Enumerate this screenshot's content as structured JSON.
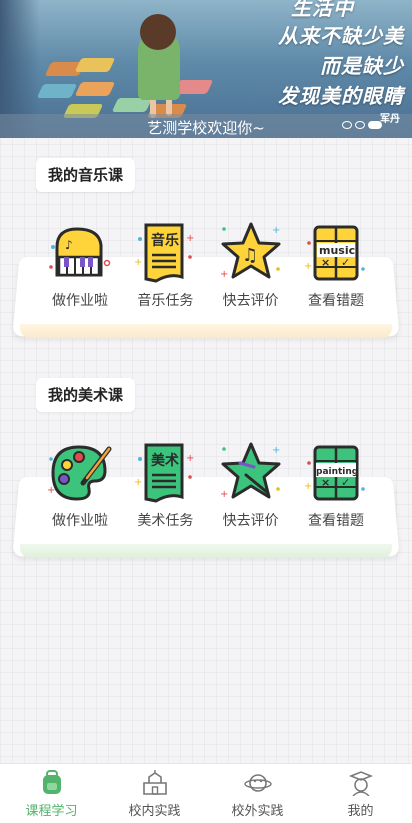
{
  "banner": {
    "lines": [
      "生活中",
      "从来不缺少美",
      "而是缺少",
      "发现美的眼睛"
    ],
    "caption": "艺测学校欢迎你~",
    "watermark": "军丹"
  },
  "music": {
    "title": "我的音乐课",
    "items": [
      {
        "label": "做作业啦",
        "icon": "piano-icon",
        "text": ""
      },
      {
        "label": "音乐任务",
        "icon": "music-task-icon",
        "text": "音乐"
      },
      {
        "label": "快去评价",
        "icon": "music-star-icon",
        "text": ""
      },
      {
        "label": "查看错题",
        "icon": "music-wrong-icon",
        "text": "music"
      }
    ]
  },
  "art": {
    "title": "我的美术课",
    "items": [
      {
        "label": "做作业啦",
        "icon": "palette-icon",
        "text": ""
      },
      {
        "label": "美术任务",
        "icon": "art-task-icon",
        "text": "美术"
      },
      {
        "label": "快去评价",
        "icon": "art-star-icon",
        "text": ""
      },
      {
        "label": "查看错题",
        "icon": "art-wrong-icon",
        "text": "painting"
      }
    ]
  },
  "tabs": [
    {
      "label": "课程学习",
      "icon": "backpack-icon",
      "active": true
    },
    {
      "label": "校内实践",
      "icon": "school-icon",
      "active": false
    },
    {
      "label": "校外实践",
      "icon": "planet-icon",
      "active": false
    },
    {
      "label": "我的",
      "icon": "graduate-icon",
      "active": false
    }
  ],
  "colors": {
    "accent": "#52b36a",
    "music_yellow": "#ffd43b",
    "art_green": "#3cc47c",
    "outline": "#2b2b2b"
  }
}
